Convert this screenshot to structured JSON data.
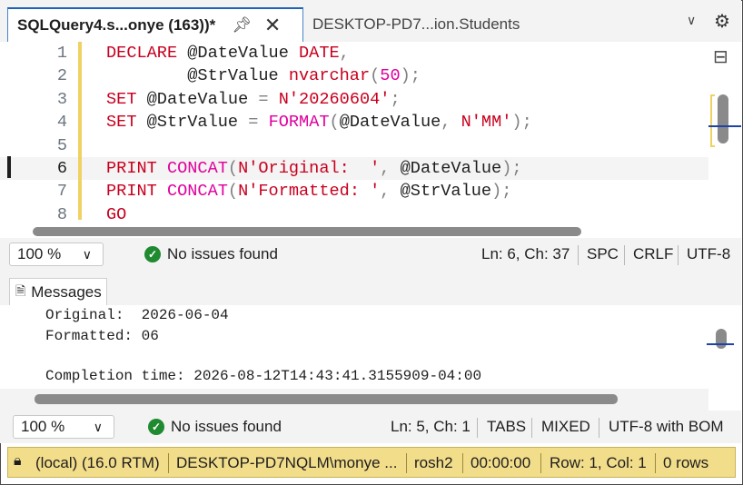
{
  "tabs": {
    "active_title": "SQLQuery4.s...onye (163))*",
    "inactive_title": "DESKTOP-PD7...ion.Students"
  },
  "icons": {
    "pin": "pin-icon",
    "close": "close-icon",
    "chevron": "chevron-down-icon",
    "settings": "gear-icon",
    "split": "split-editor-icon",
    "ok": "check-circle-icon",
    "messages": "messages-icon",
    "lock": "lock-icon"
  },
  "editor": {
    "lines": [
      {
        "n": "1",
        "tokens": [
          [
            "kw",
            "DECLARE "
          ],
          [
            "id",
            "@DateValue "
          ],
          [
            "kw",
            "DATE"
          ],
          [
            "pu",
            ","
          ]
        ]
      },
      {
        "n": "2",
        "tokens": [
          [
            "id",
            "        @StrValue "
          ],
          [
            "kw",
            "nvarchar"
          ],
          [
            "pu",
            "("
          ],
          [
            "num",
            "50"
          ],
          [
            "pu",
            ");"
          ]
        ]
      },
      {
        "n": "3",
        "tokens": [
          [
            "kw",
            "SET "
          ],
          [
            "id",
            "@DateValue "
          ],
          [
            "pu",
            "= "
          ],
          [
            "str",
            "N'20260604'"
          ],
          [
            "pu",
            ";"
          ]
        ]
      },
      {
        "n": "4",
        "tokens": [
          [
            "kw",
            "SET "
          ],
          [
            "id",
            "@StrValue "
          ],
          [
            "pu",
            "= "
          ],
          [
            "fn",
            "FORMAT"
          ],
          [
            "pu",
            "("
          ],
          [
            "id",
            "@DateValue"
          ],
          [
            "pu",
            ", "
          ],
          [
            "str",
            "N'MM'"
          ],
          [
            "pu",
            ");"
          ]
        ]
      },
      {
        "n": "5",
        "tokens": []
      },
      {
        "n": "6",
        "tokens": [
          [
            "kw",
            "PRINT "
          ],
          [
            "fn",
            "CONCAT"
          ],
          [
            "pu",
            "("
          ],
          [
            "str",
            "N'Original:  '"
          ],
          [
            "pu",
            ", "
          ],
          [
            "id",
            "@DateValue"
          ],
          [
            "pu",
            ");"
          ]
        ]
      },
      {
        "n": "7",
        "tokens": [
          [
            "kw",
            "PRINT "
          ],
          [
            "fn",
            "CONCAT"
          ],
          [
            "pu",
            "("
          ],
          [
            "str",
            "N'Formatted: '"
          ],
          [
            "pu",
            ", "
          ],
          [
            "id",
            "@StrValue"
          ],
          [
            "pu",
            ");"
          ]
        ]
      },
      {
        "n": "8",
        "tokens": [
          [
            "kw",
            "GO"
          ]
        ]
      }
    ]
  },
  "status1": {
    "zoom": "100 %",
    "issues": "No issues found",
    "position": "Ln: 6, Ch: 37",
    "whitespace": "SPC",
    "line_ending": "CRLF",
    "encoding": "UTF-8"
  },
  "messages": {
    "tab_label": "Messages",
    "lines": [
      "Original:  2026-06-04",
      "Formatted: 06",
      "",
      "Completion time: 2026-08-12T14:43:41.3155909-04:00"
    ]
  },
  "status2": {
    "zoom": "100 %",
    "issues": "No issues found",
    "position": "Ln: 5, Ch: 1",
    "whitespace": "TABS",
    "line_ending": "MIXED",
    "encoding": "UTF-8 with BOM"
  },
  "connection": {
    "server": "(local) (16.0 RTM)",
    "login": "DESKTOP-PD7NQLM\\monye ...",
    "database": "rosh2",
    "elapsed": "00:00:00",
    "cursor": "Row: 1, Col: 1",
    "rows": "0 rows"
  },
  "colors": {
    "keyword": "#c8001e",
    "function": "#e0009c",
    "connection_bar": "#f2dd8a",
    "ok_green": "#1f8a2f"
  }
}
